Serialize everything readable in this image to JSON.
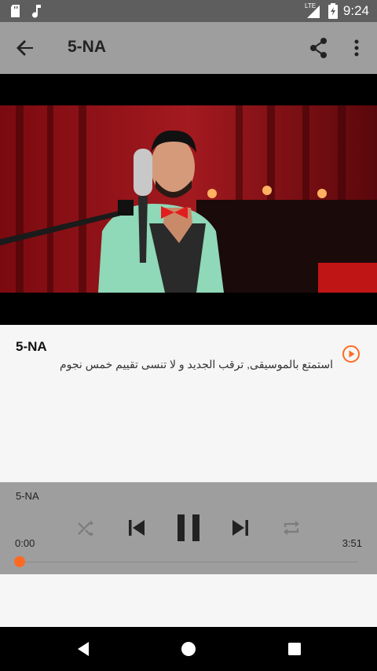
{
  "status_bar": {
    "time": "9:24",
    "network": "LTE",
    "icons": [
      "sd-card-icon",
      "music-note-icon",
      "signal-icon",
      "battery-icon"
    ]
  },
  "app_bar": {
    "title": "5-NA",
    "icons": [
      "back-arrow-icon",
      "share-icon",
      "more-vert-icon"
    ]
  },
  "track": {
    "title": "5-NA",
    "description": "استمتع بالموسيقى, ترقب الجديد و لا تنسى تقييم خمس نجوم"
  },
  "player": {
    "title": "5-NA",
    "current_time": "0:00",
    "total_time": "3:51",
    "progress_fraction": 0.0,
    "controls": [
      "shuffle-icon",
      "previous-icon",
      "pause-icon",
      "next-icon",
      "repeat-icon"
    ]
  },
  "colors": {
    "accent": "#ff6a22",
    "app_bar": "#9e9e9e",
    "status_bar": "#5e5e5e"
  }
}
